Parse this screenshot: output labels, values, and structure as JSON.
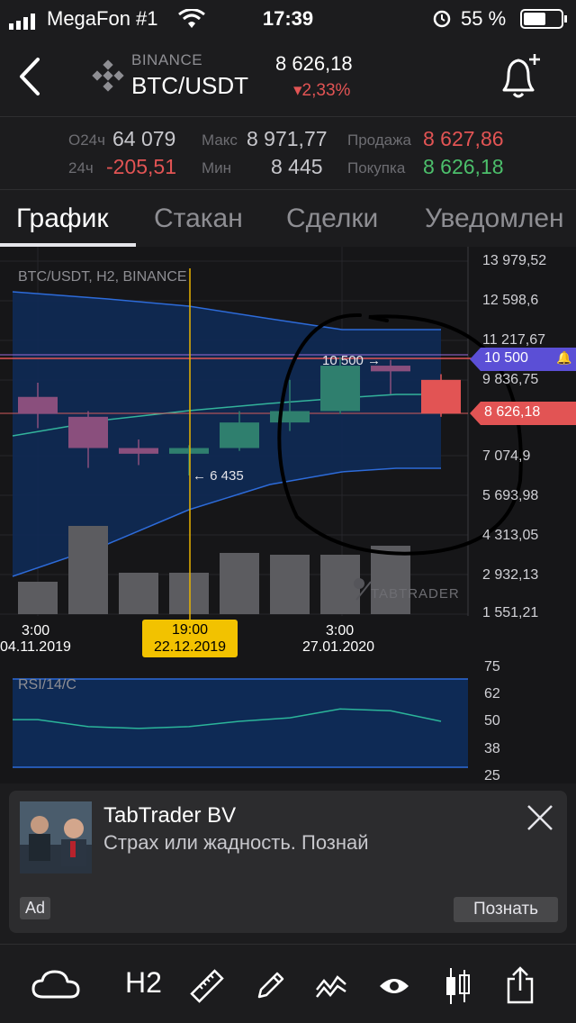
{
  "status_bar": {
    "carrier": "MegaFon #1",
    "time": "17:39",
    "battery": "55 %"
  },
  "header": {
    "exchange": "BINANCE",
    "pair": "BTC/USDT",
    "price": "8 626,18",
    "change": "▾2,33%"
  },
  "stats": {
    "volume_label": "O24ч",
    "volume_value": "64 079",
    "change24_label": "24ч",
    "change24_value": "-205,51",
    "max_label": "Макс",
    "max_value": "8 971,77",
    "min_label": "Мин",
    "min_value": "8 445",
    "sell_label": "Продажа",
    "sell_value": "8 627,86",
    "buy_label": "Покупка",
    "buy_value": "8 626,18"
  },
  "tabs": [
    "График",
    "Стакан",
    "Сделки",
    "Уведомлен"
  ],
  "chart": {
    "legend": "BTC/USDT, H2, BINANCE",
    "y_ticks": [
      "13 979,52",
      "12 598,6",
      "11 217,67",
      "9 836,75",
      "7 074,9",
      "5 693,98",
      "4 313,05",
      "2 932,13",
      "1 551,21"
    ],
    "alert_label": "10 500",
    "price_label": "8 626,18",
    "alert_marker": "10 500 →",
    "low_marker": "← 6 435",
    "watermark": "TABTRADER",
    "x_left_time": "3:00",
    "x_left_date": "04.11.2019",
    "x_cursor_time": "19:00",
    "x_cursor_date": "22.12.2019",
    "x_right_time": "3:00",
    "x_right_date": "27.01.2020",
    "rsi_legend": "RSI/14/C",
    "rsi_ticks": [
      "75",
      "62",
      "50",
      "38",
      "25"
    ]
  },
  "chart_data": {
    "type": "candlestick",
    "y_range": [
      1551.21,
      13979.52
    ],
    "candles": [
      {
        "open": 8600,
        "close": 9200,
        "high": 9700,
        "low": 8100,
        "color": "#8a4f7d"
      },
      {
        "open": 8500,
        "close": 7400,
        "high": 8700,
        "low": 6700,
        "color": "#8a4f7d"
      },
      {
        "open": 7400,
        "close": 7200,
        "high": 7700,
        "low": 6800,
        "color": "#8a4f7d"
      },
      {
        "open": 7200,
        "close": 7400,
        "high": 7500,
        "low": 6435,
        "color": "#2f7f6e"
      },
      {
        "open": 7400,
        "close": 8300,
        "high": 8700,
        "low": 7300,
        "color": "#2f7f6e"
      },
      {
        "open": 8300,
        "close": 8700,
        "high": 9800,
        "low": 8000,
        "color": "#2f7f6e"
      },
      {
        "open": 8700,
        "close": 10300,
        "high": 10600,
        "low": 8600,
        "color": "#2f7f6e"
      },
      {
        "open": 10300,
        "close": 10100,
        "high": 10500,
        "low": 9300,
        "color": "#8a4f7d"
      },
      {
        "open": 9800,
        "close": 8626.18,
        "high": 10000,
        "low": 8500,
        "color": "#e25454"
      }
    ],
    "rsi_range": [
      25,
      75
    ],
    "rsi": [
      52,
      48,
      47,
      48,
      51,
      53,
      58,
      57,
      51
    ]
  },
  "ad": {
    "title": "TabTrader BV",
    "text": "Страх или жадность. Познай",
    "badge": "Ad",
    "cta": "Познать"
  },
  "toolbar": {
    "timeframe": "H2"
  }
}
